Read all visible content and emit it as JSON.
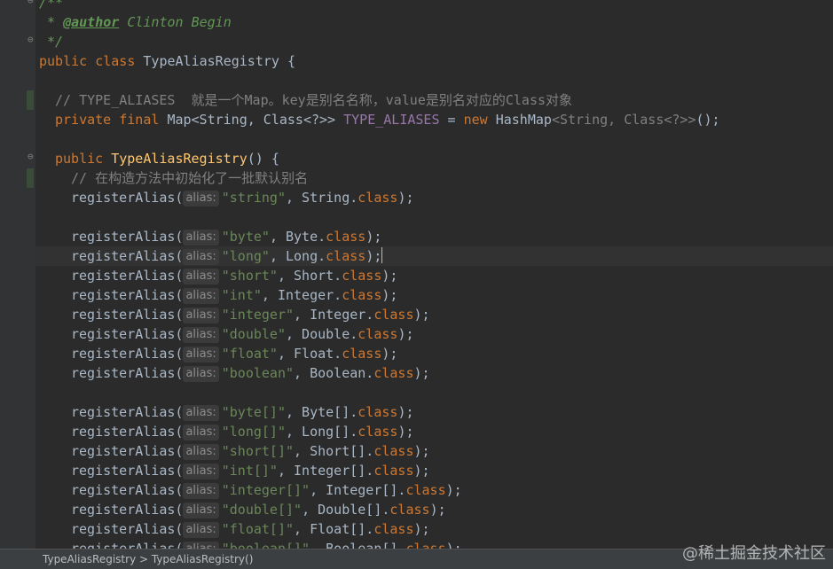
{
  "doc_comment": {
    "open": "/**",
    "author_prefix": " * ",
    "author_tag": "@author",
    "author_name": " Clinton Begin",
    "close": " */"
  },
  "class_decl": {
    "modifier": "public ",
    "keyword": "class ",
    "name": "TypeAliasRegistry",
    "brace": " {"
  },
  "field_comment": "// TYPE_ALIASES  就是一个Map。key是别名名称，value是别名对应的Class对象",
  "field_decl": {
    "modifiers": "private final ",
    "type": "Map<String, Class<?>> ",
    "name": "TYPE_ALIASES",
    "assign": " = ",
    "new_kw": "new ",
    "ctor_type": "HashMap",
    "generic": "<String, Class<?>>",
    "end": "();"
  },
  "constructor": {
    "modifier": "public ",
    "name": "TypeAliasRegistry",
    "params": "() {",
    "comment": "// 在构造方法中初始化了一批默认别名"
  },
  "call_name": "registerAlias(",
  "hint_label": "alias:",
  "class_kw": "class",
  "registrations": [
    {
      "alias": "\"string\"",
      "type": "String"
    },
    {
      "alias": "\"byte\"",
      "type": "Byte"
    },
    {
      "alias": "\"long\"",
      "type": "Long"
    },
    {
      "alias": "\"short\"",
      "type": "Short"
    },
    {
      "alias": "\"int\"",
      "type": "Integer"
    },
    {
      "alias": "\"integer\"",
      "type": "Integer"
    },
    {
      "alias": "\"double\"",
      "type": "Double"
    },
    {
      "alias": "\"float\"",
      "type": "Float"
    },
    {
      "alias": "\"boolean\"",
      "type": "Boolean"
    },
    {
      "alias": "\"byte[]\"",
      "type": "Byte[]"
    },
    {
      "alias": "\"long[]\"",
      "type": "Long[]"
    },
    {
      "alias": "\"short[]\"",
      "type": "Short[]"
    },
    {
      "alias": "\"int[]\"",
      "type": "Integer[]"
    },
    {
      "alias": "\"integer[]\"",
      "type": "Integer[]"
    },
    {
      "alias": "\"double[]\"",
      "type": "Double[]"
    },
    {
      "alias": "\"float[]\"",
      "type": "Float[]"
    },
    {
      "alias": "\"boolean[]\"",
      "type": "Boolean[]"
    }
  ],
  "statusbar": {
    "breadcrumb": "TypeAliasRegistry  >  TypeAliasRegistry()"
  },
  "watermark": "@稀土掘金技术社区",
  "colors": {
    "background": "#2b2b2b",
    "keyword": "#cc7832",
    "string": "#6a8759",
    "method": "#ffc66d",
    "field": "#9876aa",
    "comment": "#808080"
  }
}
